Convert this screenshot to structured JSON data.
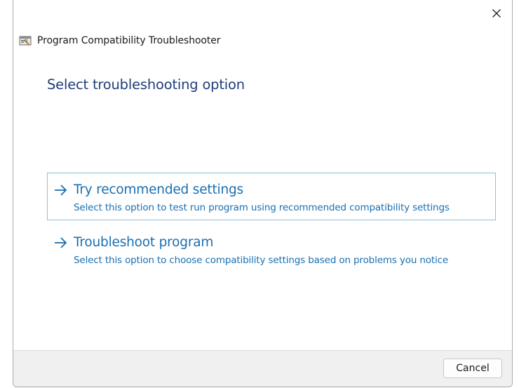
{
  "window": {
    "app_title": "Program Compatibility Troubleshooter",
    "app_icon": "troubleshooter-app-icon",
    "close_icon": "close-icon"
  },
  "main": {
    "page_title": "Select troubleshooting option",
    "options": [
      {
        "title": "Try recommended settings",
        "description": "Select this option to test run program using recommended compatibility settings",
        "icon": "arrow-right-icon",
        "highlighted": true
      },
      {
        "title": "Troubleshoot program",
        "description": "Select this option to choose compatibility settings based on problems you notice",
        "icon": "arrow-right-icon",
        "highlighted": false
      }
    ]
  },
  "footer": {
    "cancel_label": "Cancel"
  },
  "colors": {
    "page_title": "#1f3e7a",
    "option_text": "#1a6fb0",
    "highlight_border": "#8bbfe0",
    "footer_bg": "#f0f0f0"
  }
}
